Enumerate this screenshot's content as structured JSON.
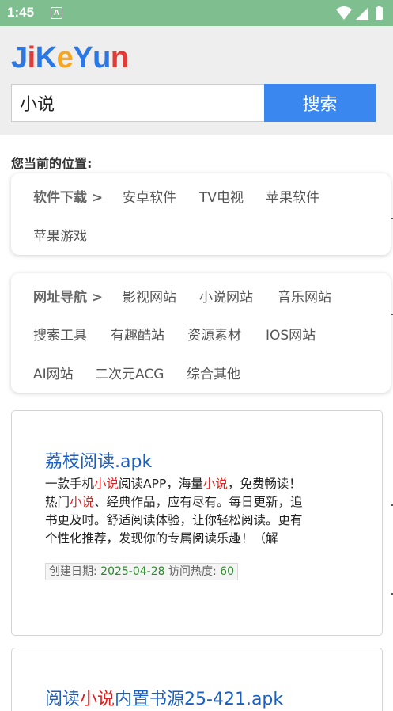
{
  "status": {
    "time": "1:45",
    "notif_letter": "A"
  },
  "logo": {
    "letters": [
      "J",
      "i",
      "K",
      "e",
      "Y",
      "u",
      "n"
    ],
    "colors": [
      "#2b78e4",
      "#e53935",
      "#2b78e4",
      "#f5a623",
      "#2b78e4",
      "#2b78e4",
      "#e53935"
    ]
  },
  "search": {
    "value": "小说",
    "button": "搜索"
  },
  "location_label": "您当前的位置:",
  "software": {
    "head": "软件下载 >",
    "items": [
      "安卓软件",
      "TV电视",
      "苹果软件",
      "苹果游戏"
    ]
  },
  "sites": {
    "head": "网址导航 >",
    "items": [
      "影视网站",
      "小说网站",
      "音乐网站",
      "搜索工具",
      "有趣酷站",
      "资源素材",
      "IOS网站",
      "AI网站",
      "二次元ACG",
      "综合其他"
    ]
  },
  "result1": {
    "title": "荔枝阅读.apk",
    "line1": [
      "一款手机",
      "小说",
      "阅读APP，海量",
      "小说",
      "，免费畅读！"
    ],
    "line2": [
      "热门",
      "小说",
      "、经典作品，应有尽有。每日更新，追"
    ],
    "line3": "书更及时。舒适阅读体验，让你轻松阅读。更有",
    "line4": "个性化推荐，发现你的专属阅读乐趣！（解",
    "date_label": "创建日期:",
    "date": "2025-04-28",
    "heat_label": "访问热度:",
    "heat": "60"
  },
  "result2": {
    "title": [
      "阅读",
      "小说",
      "内置书源25-421.apk"
    ]
  }
}
